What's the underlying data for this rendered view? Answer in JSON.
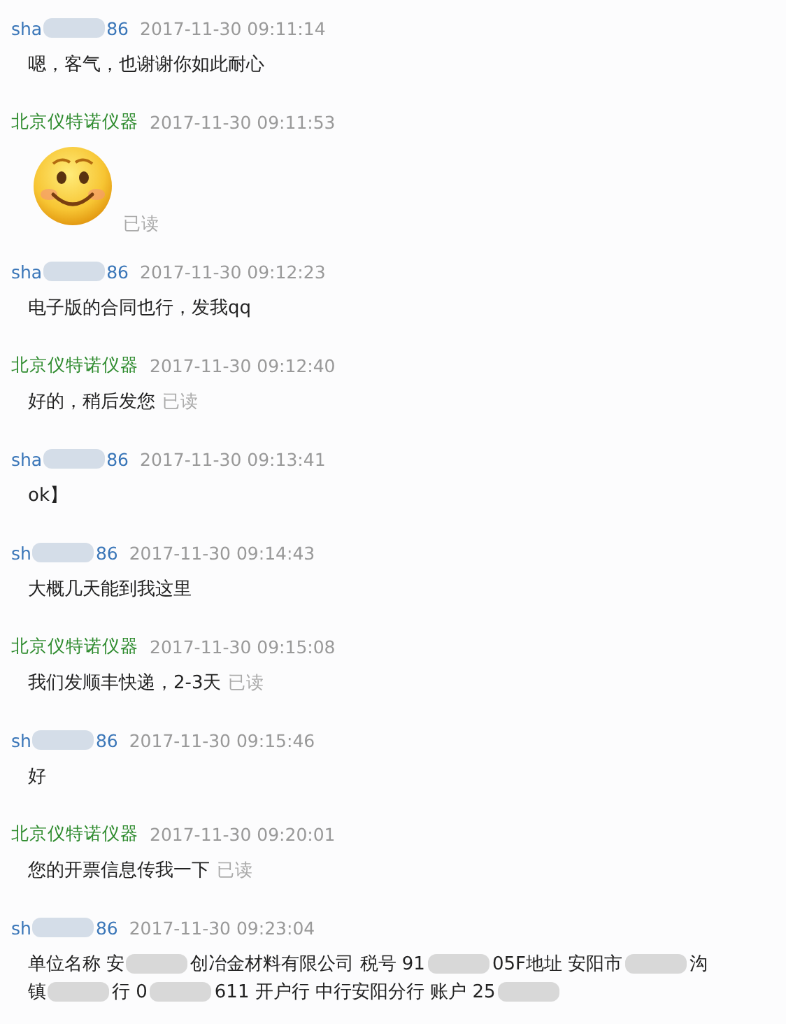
{
  "messages": [
    {
      "sender": {
        "start": "sha",
        "end": "86",
        "color": "#3a76b8"
      },
      "time": "2017-11-30 09:11:14",
      "content": {
        "kind": "text",
        "lines": [
          [
            {
              "kind": "text",
              "text": "嗯，客气，也谢谢你如此耐心"
            }
          ]
        ]
      }
    },
    {
      "sender": {
        "start": "北京仪特诺仪器",
        "color": "#2e8b2e"
      },
      "time": "2017-11-30 09:11:53",
      "content": {
        "kind": "emoji"
      },
      "read_label": "已读"
    },
    {
      "sender": {
        "start": "sha",
        "end": "86",
        "color": "#3a76b8"
      },
      "time": "2017-11-30 09:12:23",
      "content": {
        "kind": "text",
        "lines": [
          [
            {
              "kind": "text",
              "text": "电子版的合同也行，发我qq"
            }
          ]
        ]
      }
    },
    {
      "sender": {
        "start": "北京仪特诺仪器",
        "color": "#2e8b2e"
      },
      "time": "2017-11-30 09:12:40",
      "content": {
        "kind": "text",
        "lines": [
          [
            {
              "kind": "text",
              "text": "好的，稍后发您"
            }
          ]
        ]
      },
      "read_label": "已读"
    },
    {
      "sender": {
        "start": "sha",
        "end": "86",
        "color": "#3a76b8"
      },
      "time": "2017-11-30 09:13:41",
      "content": {
        "kind": "text",
        "lines": [
          [
            {
              "kind": "text",
              "text": "ok】"
            }
          ]
        ]
      }
    },
    {
      "sender": {
        "start": "sh",
        "end": "86",
        "color": "#3a76b8"
      },
      "time": "2017-11-30 09:14:43",
      "content": {
        "kind": "text",
        "lines": [
          [
            {
              "kind": "text",
              "text": "大概几天能到我这里"
            }
          ]
        ]
      }
    },
    {
      "sender": {
        "start": "北京仪特诺仪器",
        "color": "#2e8b2e"
      },
      "time": "2017-11-30 09:15:08",
      "content": {
        "kind": "text",
        "lines": [
          [
            {
              "kind": "text",
              "text": "我们发顺丰快递，2-3天"
            }
          ]
        ]
      },
      "read_label": "已读"
    },
    {
      "sender": {
        "start": "sh",
        "end": "86",
        "color": "#3a76b8"
      },
      "time": "2017-11-30 09:15:46",
      "content": {
        "kind": "text",
        "lines": [
          [
            {
              "kind": "text",
              "text": "好"
            }
          ]
        ]
      }
    },
    {
      "sender": {
        "start": "北京仪特诺仪器",
        "color": "#2e8b2e"
      },
      "time": "2017-11-30 09:20:01",
      "content": {
        "kind": "text",
        "lines": [
          [
            {
              "kind": "text",
              "text": "您的开票信息传我一下"
            }
          ]
        ]
      },
      "read_label": "已读"
    },
    {
      "sender": {
        "start": "sh",
        "end": "86",
        "color": "#3a76b8"
      },
      "time": "2017-11-30 09:23:04",
      "content": {
        "kind": "text",
        "lines": [
          [
            {
              "kind": "text",
              "text": "单位名称 安"
            },
            {
              "kind": "blur"
            },
            {
              "kind": "text",
              "text": "创冶金材料有限公司 税号 91"
            },
            {
              "kind": "blur"
            },
            {
              "kind": "text",
              "text": "05F地址 安阳市"
            },
            {
              "kind": "blur"
            },
            {
              "kind": "text",
              "text": "沟"
            }
          ],
          [
            {
              "kind": "text",
              "text": "镇"
            },
            {
              "kind": "blur"
            },
            {
              "kind": "text",
              "text": "行 0"
            },
            {
              "kind": "blur"
            },
            {
              "kind": "text",
              "text": "611 开户行 中行安阳分行 账户 25"
            },
            {
              "kind": "blur"
            }
          ]
        ]
      }
    }
  ]
}
